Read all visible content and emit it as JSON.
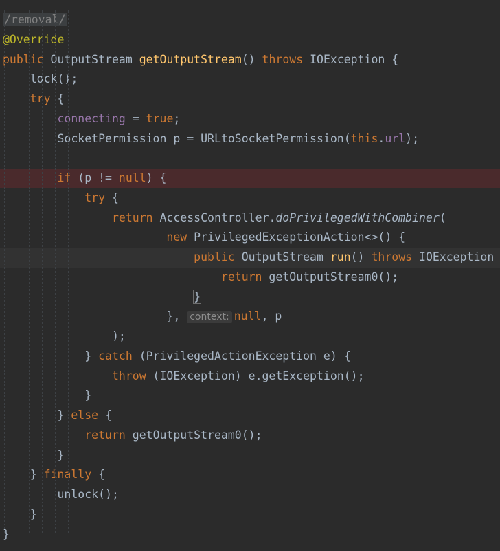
{
  "editor": {
    "lines": [
      [
        {
          "t": "/removal/",
          "c": "tag"
        }
      ],
      [
        {
          "t": "@Override",
          "c": "ann"
        }
      ],
      [
        {
          "t": "public",
          "c": "kw"
        },
        {
          "t": " ",
          "c": "ws"
        },
        {
          "t": "OutputStream"
        },
        {
          "t": " ",
          "c": "ws"
        },
        {
          "t": "getOutputStream",
          "c": "fn"
        },
        {
          "t": "()"
        },
        {
          "t": " ",
          "c": "ws"
        },
        {
          "t": "throws",
          "c": "kw"
        },
        {
          "t": " ",
          "c": "ws"
        },
        {
          "t": "IOException"
        },
        {
          "t": " ",
          "c": "ws"
        },
        {
          "t": "{"
        }
      ],
      [
        {
          "t": "    ",
          "c": "ws"
        },
        {
          "t": "lock();"
        }
      ],
      [
        {
          "t": "    ",
          "c": "ws"
        },
        {
          "t": "try",
          "c": "kw"
        },
        {
          "t": " ",
          "c": "ws"
        },
        {
          "t": "{"
        }
      ],
      [
        {
          "t": "        ",
          "c": "ws"
        },
        {
          "t": "connecting",
          "c": "fld"
        },
        {
          "t": " = "
        },
        {
          "t": "true",
          "c": "kw"
        },
        {
          "t": ";"
        }
      ],
      [
        {
          "t": "        ",
          "c": "ws"
        },
        {
          "t": "SocketPermission p = URLtoSocketPermission("
        },
        {
          "t": "this",
          "c": "kw"
        },
        {
          "t": "."
        },
        {
          "t": "url",
          "c": "fld"
        },
        {
          "t": ");"
        }
      ],
      [],
      [
        {
          "t": "        ",
          "c": "ws"
        },
        {
          "t": "if",
          "c": "kw"
        },
        {
          "t": " (p != "
        },
        {
          "t": "null",
          "c": "kw"
        },
        {
          "t": ") {"
        }
      ],
      [
        {
          "t": "            ",
          "c": "ws"
        },
        {
          "t": "try",
          "c": "kw"
        },
        {
          "t": " {"
        }
      ],
      [
        {
          "t": "                ",
          "c": "ws"
        },
        {
          "t": "return",
          "c": "kw"
        },
        {
          "t": " AccessController."
        },
        {
          "t": "doPrivilegedWithCombiner",
          "c": "it"
        },
        {
          "t": "("
        }
      ],
      [
        {
          "t": "                        ",
          "c": "ws"
        },
        {
          "t": "new",
          "c": "kw"
        },
        {
          "t": " PrivilegedExceptionAction<>() {"
        }
      ],
      [
        {
          "t": "                            ",
          "c": "ws"
        },
        {
          "t": "public",
          "c": "kw"
        },
        {
          "t": " OutputStream "
        },
        {
          "t": "run",
          "c": "fn"
        },
        {
          "t": "() "
        },
        {
          "t": "throws",
          "c": "kw"
        },
        {
          "t": " IOException "
        },
        {
          "t": "{",
          "c": "bm"
        },
        {
          "t": "",
          "c": "caret"
        }
      ],
      [
        {
          "t": "                                ",
          "c": "ws"
        },
        {
          "t": "return",
          "c": "kw"
        },
        {
          "t": " getOutputStream0();"
        }
      ],
      [
        {
          "t": "                            ",
          "c": "ws"
        },
        {
          "t": "}",
          "c": "bm"
        }
      ],
      [
        {
          "t": "                        ",
          "c": "ws"
        },
        {
          "t": "}, "
        },
        {
          "t": "context:",
          "c": "hint"
        },
        {
          "t": "null",
          "c": "kw"
        },
        {
          "t": ", p"
        }
      ],
      [
        {
          "t": "                ",
          "c": "ws"
        },
        {
          "t": ");"
        }
      ],
      [
        {
          "t": "            ",
          "c": "ws"
        },
        {
          "t": "} "
        },
        {
          "t": "catch",
          "c": "kw"
        },
        {
          "t": " (PrivilegedActionException e) {"
        }
      ],
      [
        {
          "t": "                ",
          "c": "ws"
        },
        {
          "t": "throw",
          "c": "kw"
        },
        {
          "t": " (IOException) e.getException();"
        }
      ],
      [
        {
          "t": "            ",
          "c": "ws"
        },
        {
          "t": "}"
        }
      ],
      [
        {
          "t": "        ",
          "c": "ws"
        },
        {
          "t": "} "
        },
        {
          "t": "else",
          "c": "kw"
        },
        {
          "t": " {"
        }
      ],
      [
        {
          "t": "            ",
          "c": "ws"
        },
        {
          "t": "return",
          "c": "kw"
        },
        {
          "t": " getOutputStream0();"
        }
      ],
      [
        {
          "t": "        ",
          "c": "ws"
        },
        {
          "t": "}"
        }
      ],
      [
        {
          "t": "    ",
          "c": "ws"
        },
        {
          "t": "} "
        },
        {
          "t": "finally",
          "c": "kw"
        },
        {
          "t": " {"
        }
      ],
      [
        {
          "t": "        ",
          "c": "ws"
        },
        {
          "t": "unlock();"
        }
      ],
      [
        {
          "t": "    ",
          "c": "ws"
        },
        {
          "t": "}"
        }
      ],
      [
        {
          "t": "}"
        }
      ]
    ],
    "error_line": 8,
    "caret_line": 12
  }
}
